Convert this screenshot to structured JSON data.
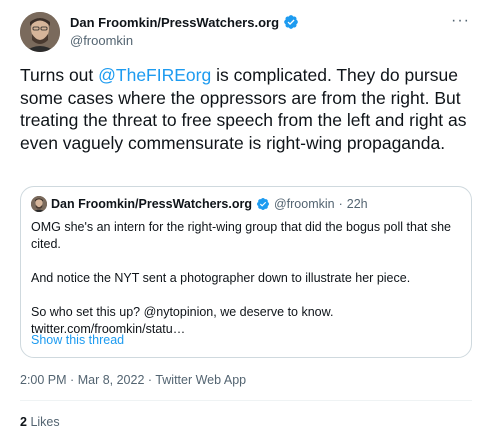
{
  "author": {
    "name": "Dan Froomkin/PressWatchers.org",
    "handle": "@froomkin"
  },
  "more_label": "···",
  "tweet": {
    "text_before": "Turns out ",
    "mention": "@TheFIREorg",
    "text_after": " is complicated. They do pursue some cases where the oppressors are from the right. But treating the threat to free speech from the left and right as even vaguely commensurate is right-wing propaganda."
  },
  "quoted": {
    "name": "Dan Froomkin/PressWatchers.org",
    "handle": "@froomkin",
    "separator": "·",
    "time": "22h",
    "lines": [
      "OMG she's an intern for the right-wing group that did the bogus poll that she cited.",
      "And notice the NYT sent a photographer down to illustrate her piece.",
      "So who set this up? @nytopinion, we deserve to know.",
      "twitter.com/froomkin/statu…"
    ],
    "show_thread": "Show this thread"
  },
  "meta": {
    "time": "2:00 PM",
    "sep": "·",
    "date": "Mar 8, 2022",
    "source": "Twitter Web App"
  },
  "stats": {
    "likes_count": "2",
    "likes_label": "Likes"
  },
  "colors": {
    "accent": "#1d9bf0",
    "text": "#0f1419",
    "muted": "#536471",
    "border": "#cfd9de"
  }
}
